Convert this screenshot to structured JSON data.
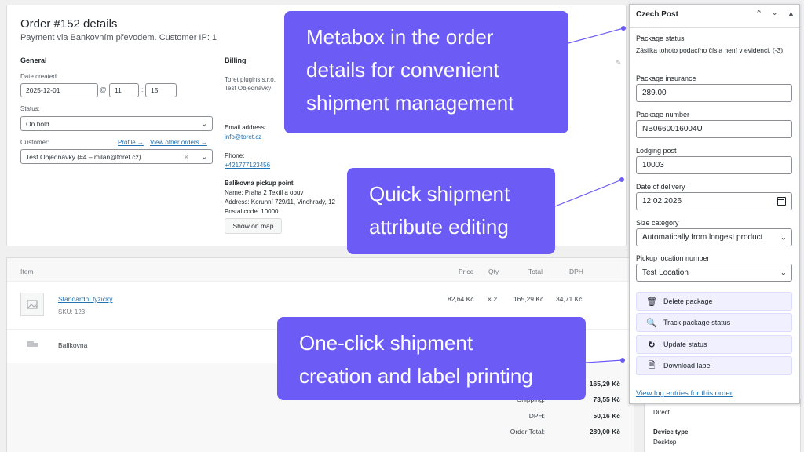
{
  "order": {
    "title": "Order #152 details",
    "subtitle": "Payment via Bankovním převodem. Customer IP: 1",
    "general_heading": "General",
    "date_label": "Date created:",
    "date_value": "2025-12-01",
    "at_sign": "@",
    "hour": "11",
    "colon": ":",
    "minute": "15",
    "status_label": "Status:",
    "status_value": "On hold",
    "customer_label": "Customer:",
    "profile_link": "Profile →",
    "other_orders_link": "View other orders →",
    "customer_value": "Test Objednávky (#4 – milan@toret.cz)",
    "billing_heading": "Billing",
    "billing_lines": [
      "Toret plugins s.r.o.",
      "Test Objednávky"
    ],
    "email_label": "Email address:",
    "email_value": "info@toret.cz",
    "phone_label": "Phone:",
    "phone_value": "+421777123456",
    "pickup_heading": "Balikovna pickup point",
    "pickup_name": "Name: Praha 2 Textil a obuv",
    "pickup_address": "Address: Korunní 729/11, Vinohrady, 12",
    "pickup_postal": "Postal code: 10000",
    "show_map": "Show on map"
  },
  "items": {
    "headers": {
      "item": "Item",
      "price": "Price",
      "qty": "Qty",
      "total": "Total",
      "dph": "DPH"
    },
    "rows": [
      {
        "name": "Standardní fyzický",
        "sku": "SKU: 123",
        "price": "82,64 Kč",
        "qty": "× 2",
        "total": "165,29 Kč",
        "dph": "34,71 Kč"
      }
    ],
    "shipping_name": "Balíkovna",
    "totals": [
      {
        "label": "",
        "value": "165,29 Kč"
      },
      {
        "label": "Shipping:",
        "value": "73,55 Kč"
      },
      {
        "label": "DPH:",
        "value": "50,16 Kč"
      },
      {
        "label": "Order Total:",
        "value": "289,00 Kč"
      }
    ]
  },
  "side_panel": {
    "direct": "Direct",
    "device_label": "Device type",
    "device_value": "Desktop"
  },
  "metabox": {
    "title": "Czech Post",
    "status_label": "Package status",
    "status_text": "Zásilka tohoto podacího čísla není v evidenci. (-3)",
    "insurance_label": "Package insurance",
    "insurance_value": "289.00",
    "number_label": "Package number",
    "number_value": "NB0660016004U",
    "lodging_label": "Lodging post",
    "lodging_value": "10003",
    "delivery_label": "Date of delivery",
    "delivery_value": "12.02.2026",
    "size_label": "Size category",
    "size_value": "Automatically from longest product",
    "pickup_label": "Pickup location number",
    "pickup_value": "Test Location",
    "buttons": {
      "delete": "Delete package",
      "track": "Track package status",
      "update": "Update status",
      "download": "Download label"
    },
    "log_link": "View log entries for this order"
  },
  "callouts": {
    "one": [
      "Metabox in the order",
      "details for convenient",
      "shipment management"
    ],
    "two": [
      "Quick shipment",
      "attribute editing"
    ],
    "three": [
      "One-click shipment",
      "creation and label printing"
    ]
  },
  "colors": {
    "accent": "#6c5cf5",
    "link": "#2271b1"
  }
}
